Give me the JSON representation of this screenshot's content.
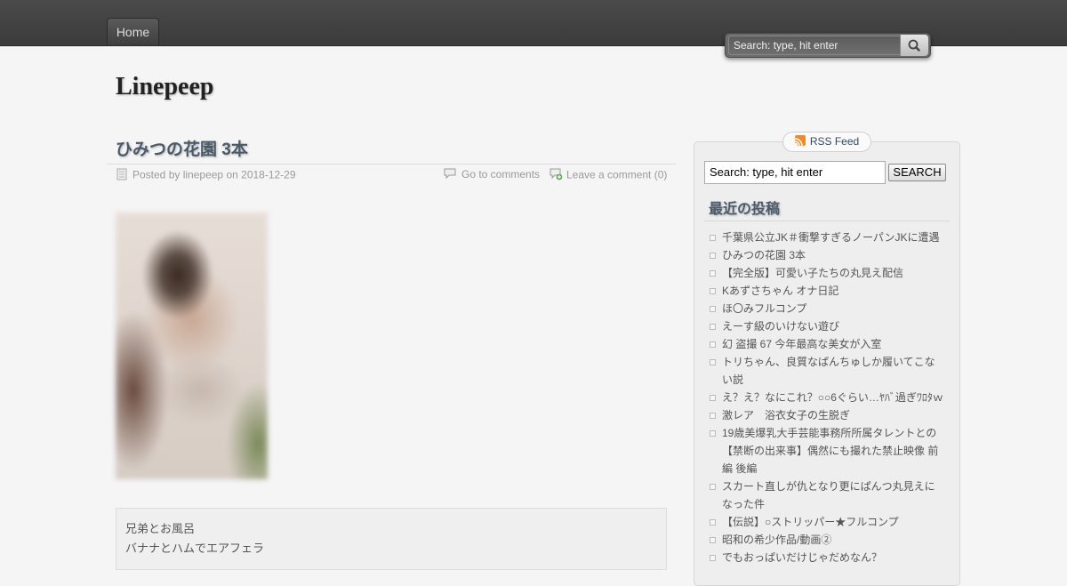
{
  "nav": {
    "home_label": "Home"
  },
  "header_search": {
    "placeholder": "Search: type, hit enter"
  },
  "site": {
    "title": "Linepeep"
  },
  "post": {
    "title": "ひみつの花園 3本",
    "posted_by_prefix": "Posted by",
    "author": "linepeep",
    "on_word": "on",
    "date": "2018-12-29",
    "go_to_comments": "Go to comments",
    "leave_comment": "Leave a comment (0)",
    "lines": [
      "兄弟とお風呂",
      "バナナとハムでエアフェラ"
    ]
  },
  "sidebar": {
    "rss_label": "RSS Feed",
    "search_value": "Search: type, hit enter",
    "search_button": "SEARCH",
    "recent_title": "最近の投稿",
    "recent_posts": [
      "千葉県公立JK＃衝撃すぎるノーパンJKに遭遇",
      "ひみつの花園 3本",
      "【完全版】可愛い子たちの丸見え配信",
      "Kあずさちゃん オナ日記",
      "ほ〇みフルコンプ",
      "えーす級のいけない遊び",
      "幻 盗撮 67 今年最高な美女が入室",
      "トリちゃん、良質なぱんちゅしか履いてこない説",
      "え？え？なにこれ？○○6ぐらい…ﾔﾊﾞ過ぎﾜﾛﾀｗ",
      "激レア　浴衣女子の生脱ぎ",
      "19歳美爆乳大手芸能事務所所属タレントとの【禁断の出来事】偶然にも撮れた禁止映像 前編 後編",
      "スカート直しが仇となり更にぱんつ丸見えになった件",
      "【伝説】○ストリッパー★フルコンプ",
      "昭和の希少作品/動画②",
      "でもおっぱいだけじゃだめなん？"
    ]
  }
}
